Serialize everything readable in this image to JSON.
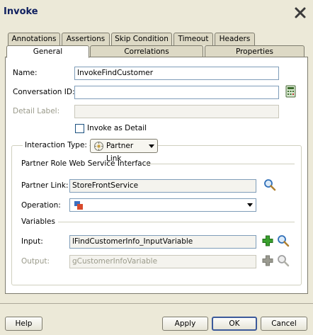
{
  "title": "Invoke",
  "tabs_row1": [
    "Annotations",
    "Assertions",
    "Skip Condition",
    "Timeout",
    "Headers"
  ],
  "tabs_row2": [
    "General",
    "Correlations",
    "Properties"
  ],
  "selected_tab": "General",
  "form": {
    "name_label": "Name:",
    "name_value": "InvokeFindCustomer",
    "conversation_label": "Conversation ID:",
    "conversation_value": "",
    "detail_label": "Detail Label:",
    "detail_value": "",
    "invoke_as_detail_label": "Invoke as Detail",
    "invoke_as_detail_checked": false,
    "interaction_type_label": "Interaction Type:",
    "interaction_type_value": "Partner Link",
    "partner_role_heading": "Partner Role Web Service Interface",
    "partner_link_label": "Partner Link:",
    "partner_link_value": "StoreFrontService",
    "operation_label": "Operation:",
    "operation_value": "",
    "variables_heading": "Variables",
    "input_label": "Input:",
    "input_value": "lFindCustomerInfo_InputVariable",
    "output_label": "Output:",
    "output_value": "gCustomerInfoVariable"
  },
  "buttons": {
    "help": "Help",
    "apply": "Apply",
    "ok": "OK",
    "cancel": "Cancel"
  },
  "colors": {
    "window_bg": "#ece9d8",
    "accent_green": "#3aa02e",
    "search_blue": "#2f6fb8"
  }
}
